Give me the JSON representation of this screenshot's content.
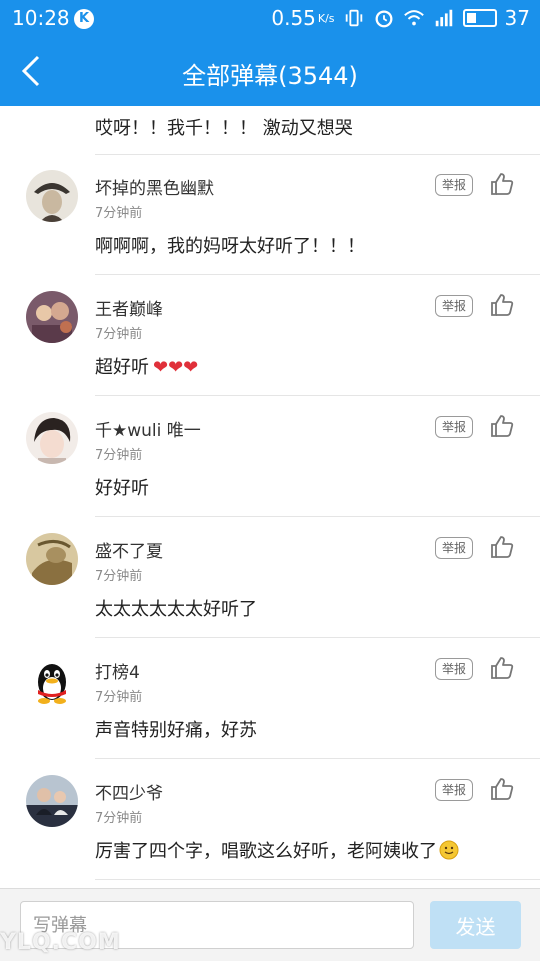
{
  "status_bar": {
    "time": "10:28",
    "k_badge": "K",
    "net_speed": "0.55",
    "net_unit": "K/s",
    "battery": "37"
  },
  "header": {
    "title": "全部弹幕(3544)"
  },
  "partial_comment": {
    "content": "哎呀！！我千！！！ 激动又想哭"
  },
  "comments": [
    {
      "name": "坏掉的黑色幽默",
      "time": "7分钟前",
      "content": "啊啊啊，我的妈呀太好听了！！！",
      "report": "举报",
      "avatar_color": "#6b5a4a"
    },
    {
      "name": "王者巅峰",
      "time": "7分钟前",
      "content": "超好听",
      "hearts": "❤❤❤",
      "report": "举报",
      "avatar_color": "#7a5a6a"
    },
    {
      "name": "千★wuli 唯一",
      "time": "7分钟前",
      "content": "好好听",
      "report": "举报",
      "avatar_color": "#c8b8b0"
    },
    {
      "name": "盛不了夏",
      "time": "7分钟前",
      "content": "太太太太太太好听了",
      "report": "举报",
      "avatar_color": "#b8a070"
    },
    {
      "name": "打榜4",
      "time": "7分钟前",
      "content": "声音特别好痛，好苏",
      "report": "举报",
      "avatar_color": "#ffffff"
    },
    {
      "name": "不四少爷",
      "time": "7分钟前",
      "content": "厉害了四个字，唱歌这么好听，老阿姨收了",
      "report": "举报",
      "avatar_color": "#3a4050"
    }
  ],
  "input": {
    "placeholder": "写弹幕"
  },
  "send_label": "发送",
  "watermark": "YLQ.COM",
  "colors": {
    "accent": "#1a91eb",
    "send_disabled": "#bfe0f5",
    "heart": "#e0303a"
  }
}
